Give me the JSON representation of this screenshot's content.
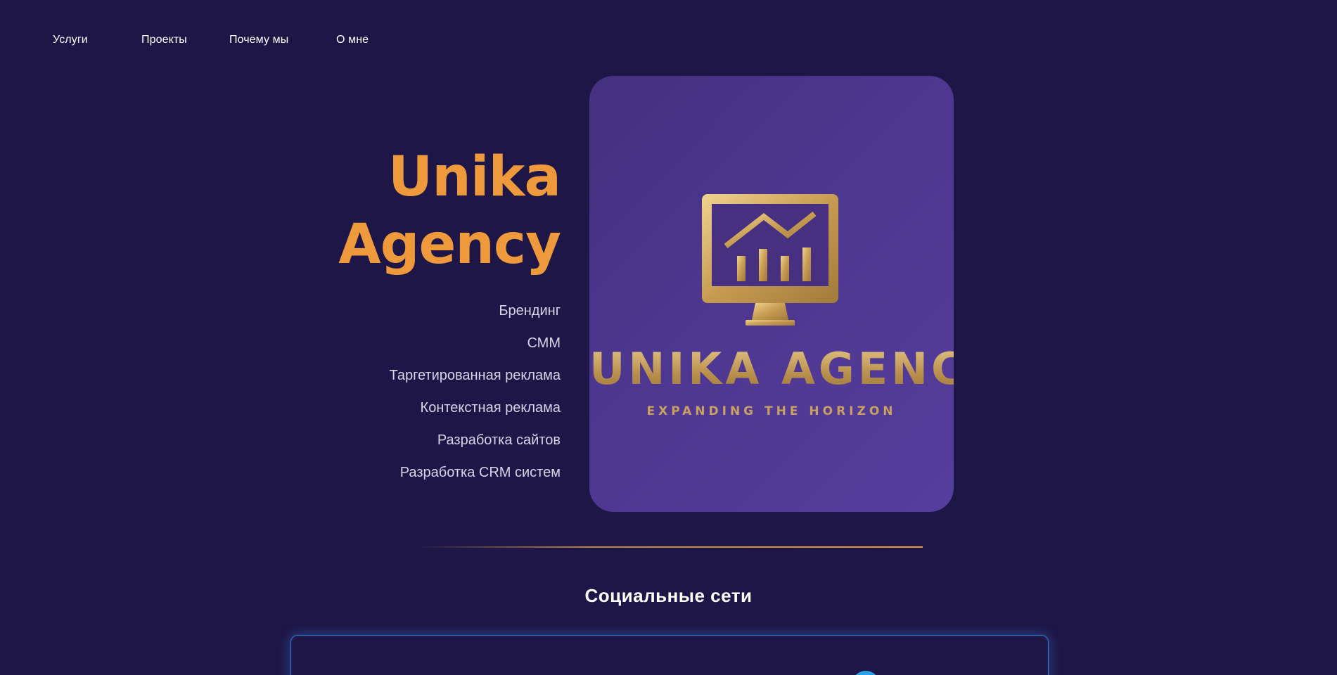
{
  "nav": {
    "items": [
      {
        "label": "Услуги"
      },
      {
        "label": "Проекты"
      },
      {
        "label": "Почему мы"
      },
      {
        "label": "О мне"
      }
    ]
  },
  "hero": {
    "title_line1": "Unika",
    "title_line2": "Agency",
    "services": [
      "Брендинг",
      "СММ",
      "Таргетированная реклама",
      "Контекстная реклама",
      "Разработка сайтов",
      "Разработка CRM систем"
    ]
  },
  "logo": {
    "name": "UNIKA AGENCY",
    "tagline": "EXPANDING THE HORIZON",
    "icon": "monitor-chart-icon"
  },
  "social": {
    "title": "Социальные сети",
    "icon": "telegram-icon"
  },
  "colors": {
    "background": "#1e1646",
    "accent": "#ee9a3c",
    "gold": "#c9a060",
    "card": "#4d3790",
    "social_border": "#2f7cd0"
  }
}
